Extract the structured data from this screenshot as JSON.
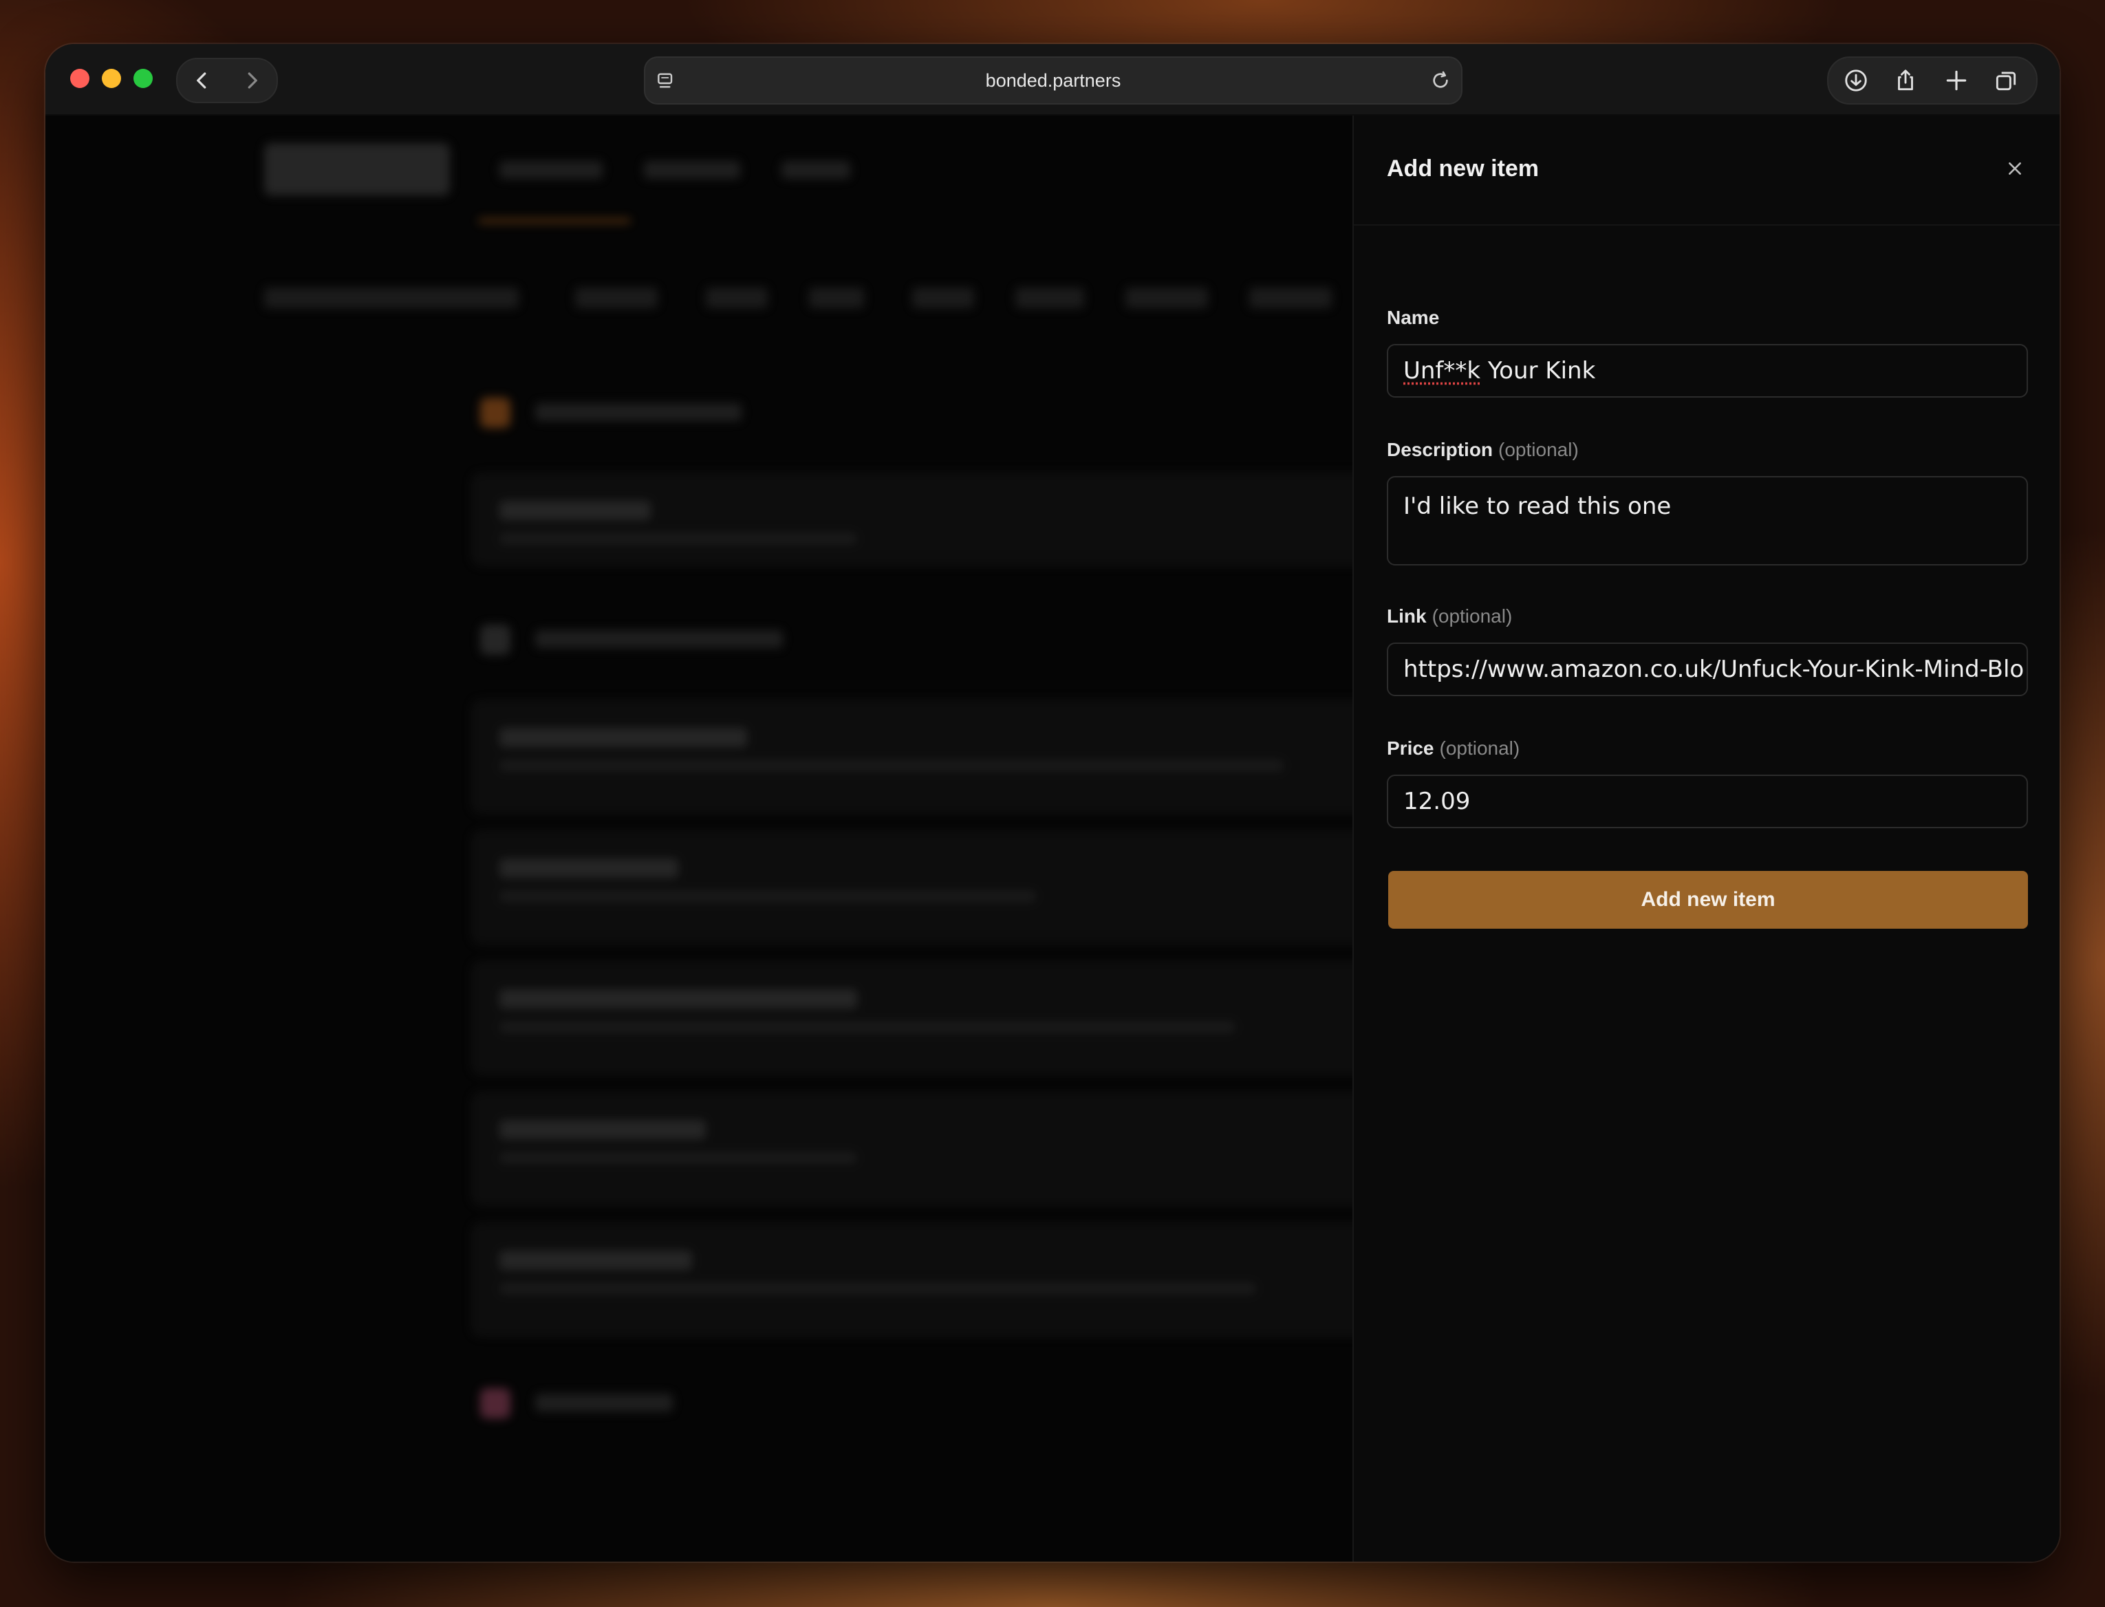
{
  "browser": {
    "url": "bonded.partners"
  },
  "panel": {
    "title": "Add new item",
    "submit_label": "Add new item",
    "optional_text": "(optional)",
    "fields": {
      "name": {
        "label": "Name",
        "value_prefix": "Unf**k",
        "value_rest": " Your Kink"
      },
      "description": {
        "label": "Description",
        "value": "I'd like to read this one"
      },
      "link": {
        "label": "Link",
        "value": "https://www.amazon.co.uk/Unfuck-Your-Kink-Mind-Blo"
      },
      "price": {
        "label": "Price",
        "value": "12.09"
      }
    }
  },
  "colors": {
    "accent": "#9a6428",
    "panel_bg": "#0a0a0a"
  },
  "icons": [
    "sidebar-icon",
    "back-icon",
    "forward-icon",
    "reload-icon",
    "download-icon",
    "share-icon",
    "new-tab-icon",
    "tabs-overview-icon",
    "close-icon"
  ]
}
